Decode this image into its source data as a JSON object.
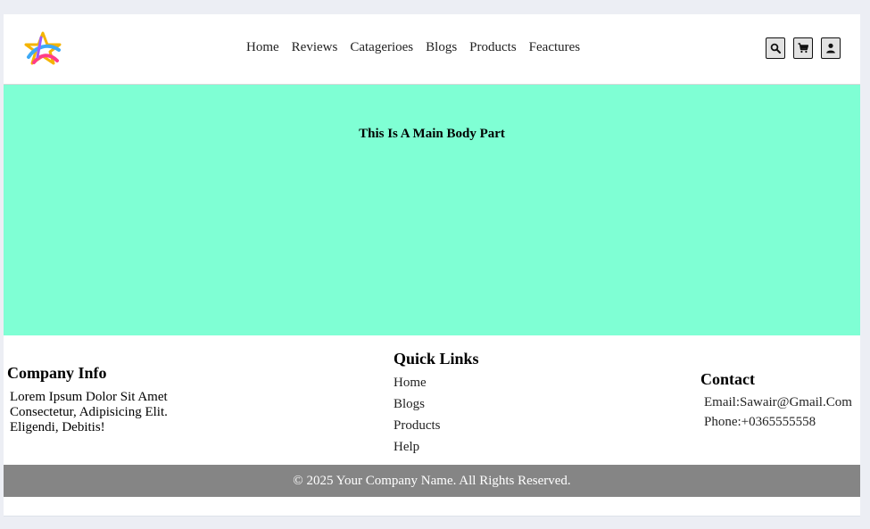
{
  "header": {
    "logo_icon": "star-swoosh-logo-icon",
    "nav": [
      "Home",
      "Reviews",
      "Catagerioes",
      "Blogs",
      "Products",
      "Feactures"
    ],
    "icons": [
      "search-icon",
      "cart-icon",
      "user-icon"
    ]
  },
  "main": {
    "title": "This Is A Main Body Part",
    "background": "#7fffd4"
  },
  "footer": {
    "company": {
      "heading": "Company Info",
      "text_lines": [
        "Lorem Ipsum Dolor Sit Amet",
        "Consectetur, Adipisicing Elit.",
        "Eligendi, Debitis!"
      ]
    },
    "quick_links": {
      "heading": "Quick Links",
      "links": [
        "Home",
        "Blogs",
        "Products",
        "Help"
      ]
    },
    "contact": {
      "heading": "Contact",
      "email": "Email:Sawair@Gmail.Com",
      "phone": "Phone:+0365555558"
    },
    "copyright": "© 2025 Your Company Name. All Rights Reserved.",
    "copyright_background": "#858585"
  }
}
